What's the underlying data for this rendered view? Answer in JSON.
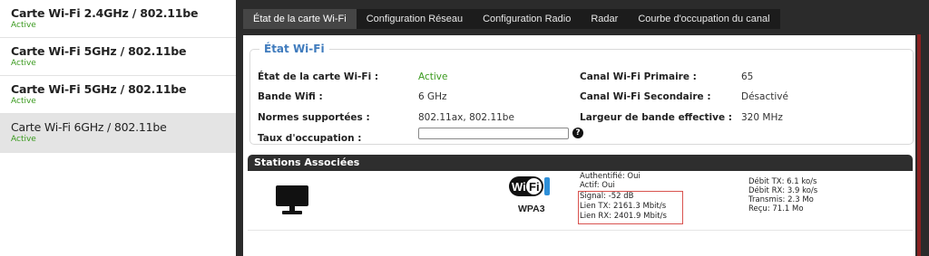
{
  "sidebar": {
    "items": [
      {
        "title": "Carte Wi-Fi 2.4GHz / 802.11be",
        "status": "Active"
      },
      {
        "title": "Carte Wi-Fi 5GHz / 802.11be",
        "status": "Active"
      },
      {
        "title": "Carte Wi-Fi 5GHz / 802.11be",
        "status": "Active"
      },
      {
        "title": "Carte Wi-Fi 6GHz / 802.11be",
        "status": "Active",
        "selected": true
      }
    ]
  },
  "tabs": [
    {
      "label": "État de la carte Wi-Fi",
      "active": true
    },
    {
      "label": "Configuration Réseau"
    },
    {
      "label": "Configuration Radio"
    },
    {
      "label": "Radar"
    },
    {
      "label": "Courbe d'occupation du canal"
    }
  ],
  "wifi_state": {
    "legend": "État Wi-Fi",
    "state_label": "État de la carte Wi-Fi :",
    "state_value": "Active",
    "band_label": "Bande Wifi :",
    "band_value": "6 GHz",
    "norms_label": "Normes supportées :",
    "norms_value": "802.11ax, 802.11be",
    "occupancy_label": "Taux d'occupation :",
    "primary_label": "Canal Wi-Fi Primaire :",
    "primary_value": "65",
    "secondary_label": "Canal Wi-Fi Secondaire :",
    "secondary_value": "Désactivé",
    "bandwidth_label": "Largeur de bande effective :",
    "bandwidth_value": "320 MHz",
    "help_glyph": "?"
  },
  "stations": {
    "header": "Stations Associées",
    "station": {
      "device_icon": "monitor-icon",
      "wifi_logo": "wifi-logo",
      "wifi_logo_text": "Wi Fi",
      "security": "WPA3",
      "authenticated": "Authentifié: Oui",
      "active": "Actif: Oui",
      "signal": "Signal: -52 dB",
      "link_tx": "Lien TX: 2161.3 Mbit/s",
      "link_rx": "Lien RX: 2401.9 Mbit/s",
      "rate_tx": "Débit TX: 6.1 ko/s",
      "rate_rx": "Débit RX: 3.9 ko/s",
      "transmitted": "Transmis: 2.3 Mo",
      "received": "Reçu: 71.1 Mo"
    }
  },
  "colors": {
    "accent_blue": "#3f7bbd",
    "active_green": "#3a9a1e",
    "highlight_red": "#d9534f"
  }
}
